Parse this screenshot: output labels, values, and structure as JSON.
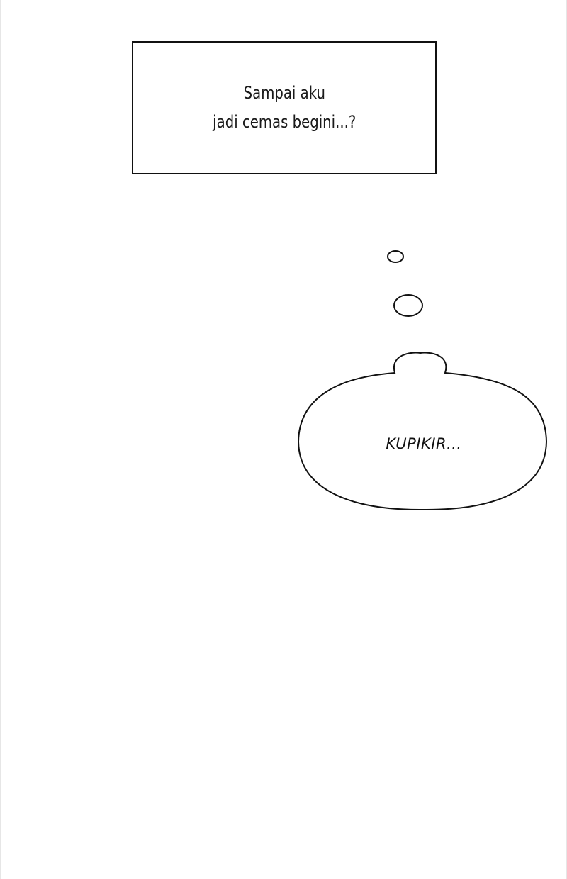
{
  "narration_box": {
    "line_1": "Sampai aku",
    "line_2": "jadi cemas begini...?"
  },
  "thought_bubble": {
    "text": "KUPIKIR..."
  },
  "colors": {
    "background": "#ffffff",
    "ink": "#111111"
  }
}
